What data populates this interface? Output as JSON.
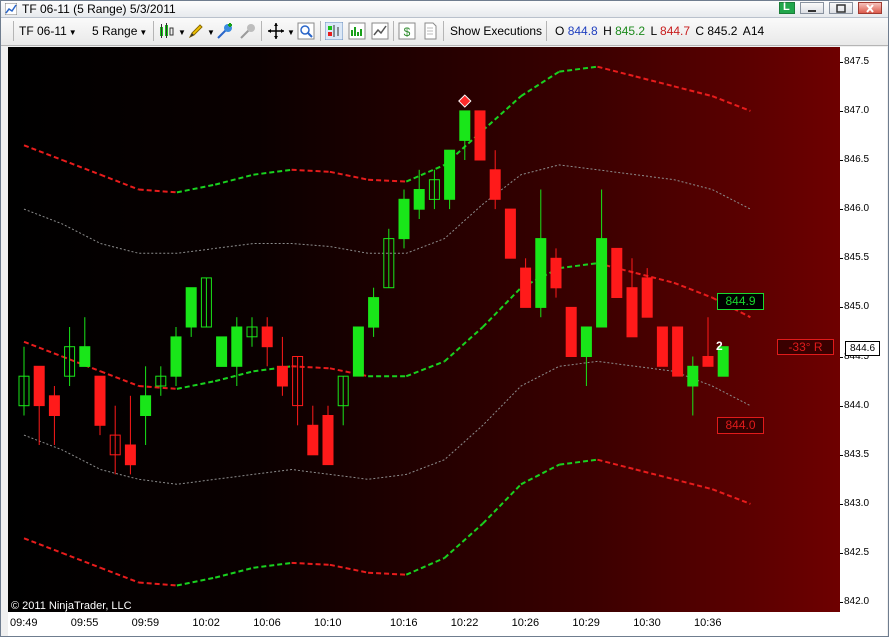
{
  "window": {
    "title": "TF 06-11 (5 Range)  5/3/2011",
    "link_button": "L"
  },
  "toolbar": {
    "instrument": "TF 06-11",
    "period": "5 Range",
    "show_executions": "Show Executions",
    "ohlc": {
      "o_label": "O",
      "o_value": "844.8",
      "h_label": "H",
      "h_value": "845.2",
      "l_label": "L",
      "l_value": "844.7",
      "c_label": "C",
      "c_value": "845.2",
      "a_label": "A",
      "a_value": "14"
    }
  },
  "chart": {
    "copyright": "© 2011 NinjaTrader, LLC",
    "last_price": "844.6",
    "upper_label": "844.9",
    "lower_label": "844.0",
    "angle_label": "-33°  R",
    "count_label": "2",
    "colors": {
      "up_candle": "#19e619",
      "down_candle": "#ff1a1a",
      "band_up": "#19d11f",
      "band_down": "#e81c1c",
      "mid_line": "#8c8c8c",
      "signal": "#ff2a2a"
    }
  },
  "y_axis": {
    "ticks": [
      "847.5",
      "847.0",
      "846.5",
      "846.0",
      "845.5",
      "845.0",
      "844.5",
      "844.0",
      "843.5",
      "843.0",
      "842.5",
      "842.0"
    ]
  },
  "x_axis": {
    "ticks": [
      "09:49",
      "09:55",
      "09:59",
      "10:02",
      "10:06",
      "10:10",
      "10:16",
      "10:22",
      "10:26",
      "10:29",
      "10:30",
      "10:36"
    ]
  },
  "chart_data": {
    "type": "candlestick",
    "title": "",
    "x_axis_ticks": [
      "09:49",
      "09:55",
      "09:59",
      "10:02",
      "10:06",
      "10:10",
      "10:16",
      "10:22",
      "10:26",
      "10:29",
      "10:30",
      "10:36"
    ],
    "ylim": [
      841.9,
      847.65
    ],
    "bars": [
      {
        "o": 844.0,
        "h": 844.6,
        "l": 843.9,
        "c": 844.3
      },
      {
        "o": 844.4,
        "h": 844.4,
        "l": 843.6,
        "c": 844.0
      },
      {
        "o": 844.1,
        "h": 844.2,
        "l": 843.6,
        "c": 843.9
      },
      {
        "o": 844.3,
        "h": 844.8,
        "l": 844.2,
        "c": 844.6
      },
      {
        "o": 844.4,
        "h": 844.9,
        "l": 844.4,
        "c": 844.6
      },
      {
        "o": 844.3,
        "h": 844.3,
        "l": 843.7,
        "c": 843.8
      },
      {
        "o": 843.7,
        "h": 844.0,
        "l": 843.3,
        "c": 843.5
      },
      {
        "o": 843.6,
        "h": 844.1,
        "l": 843.3,
        "c": 843.4
      },
      {
        "o": 843.9,
        "h": 844.4,
        "l": 843.6,
        "c": 844.1
      },
      {
        "o": 844.2,
        "h": 844.4,
        "l": 844.1,
        "c": 844.3
      },
      {
        "o": 844.3,
        "h": 844.8,
        "l": 844.2,
        "c": 844.7
      },
      {
        "o": 844.8,
        "h": 845.2,
        "l": 844.7,
        "c": 845.2
      },
      {
        "o": 844.8,
        "h": 845.3,
        "l": 844.8,
        "c": 845.3
      },
      {
        "o": 844.4,
        "h": 844.7,
        "l": 844.4,
        "c": 844.7
      },
      {
        "o": 844.4,
        "h": 844.9,
        "l": 844.2,
        "c": 844.8
      },
      {
        "o": 844.7,
        "h": 844.9,
        "l": 844.6,
        "c": 844.8
      },
      {
        "o": 844.8,
        "h": 844.9,
        "l": 844.4,
        "c": 844.6
      },
      {
        "o": 844.4,
        "h": 844.7,
        "l": 844.1,
        "c": 844.2
      },
      {
        "o": 844.5,
        "h": 844.5,
        "l": 843.8,
        "c": 844.0
      },
      {
        "o": 843.8,
        "h": 844.0,
        "l": 843.5,
        "c": 843.5
      },
      {
        "o": 843.9,
        "h": 844.0,
        "l": 843.4,
        "c": 843.4
      },
      {
        "o": 844.0,
        "h": 844.3,
        "l": 843.8,
        "c": 844.3
      },
      {
        "o": 844.3,
        "h": 844.8,
        "l": 844.3,
        "c": 844.8
      },
      {
        "o": 844.8,
        "h": 845.2,
        "l": 844.7,
        "c": 845.1
      },
      {
        "o": 845.2,
        "h": 845.8,
        "l": 845.2,
        "c": 845.7
      },
      {
        "o": 845.7,
        "h": 846.2,
        "l": 845.6,
        "c": 846.1
      },
      {
        "o": 846.0,
        "h": 846.4,
        "l": 845.9,
        "c": 846.2
      },
      {
        "o": 846.1,
        "h": 846.4,
        "l": 846.0,
        "c": 846.3
      },
      {
        "o": 846.1,
        "h": 846.4,
        "l": 846.0,
        "c": 846.6
      },
      {
        "o": 846.7,
        "h": 847.0,
        "l": 846.5,
        "c": 847.0
      },
      {
        "o": 847.0,
        "h": 847.0,
        "l": 846.5,
        "c": 846.5
      },
      {
        "o": 846.4,
        "h": 846.6,
        "l": 846.0,
        "c": 846.1
      },
      {
        "o": 846.0,
        "h": 846.0,
        "l": 845.5,
        "c": 845.5
      },
      {
        "o": 845.4,
        "h": 845.5,
        "l": 845.0,
        "c": 845.0
      },
      {
        "o": 845.0,
        "h": 846.2,
        "l": 844.9,
        "c": 845.7
      },
      {
        "o": 845.5,
        "h": 845.6,
        "l": 845.1,
        "c": 845.2
      },
      {
        "o": 845.0,
        "h": 845.0,
        "l": 844.5,
        "c": 844.5
      },
      {
        "o": 844.5,
        "h": 844.8,
        "l": 844.2,
        "c": 844.8
      },
      {
        "o": 844.8,
        "h": 846.2,
        "l": 844.8,
        "c": 845.7
      },
      {
        "o": 845.6,
        "h": 845.6,
        "l": 845.1,
        "c": 845.1
      },
      {
        "o": 845.2,
        "h": 845.5,
        "l": 844.7,
        "c": 844.7
      },
      {
        "o": 845.3,
        "h": 845.4,
        "l": 844.9,
        "c": 844.9
      },
      {
        "o": 844.8,
        "h": 844.8,
        "l": 844.4,
        "c": 844.4
      },
      {
        "o": 844.8,
        "h": 844.8,
        "l": 844.3,
        "c": 844.3
      },
      {
        "o": 844.2,
        "h": 844.5,
        "l": 843.9,
        "c": 844.4
      },
      {
        "o": 844.5,
        "h": 844.9,
        "l": 844.4,
        "c": 844.4
      },
      {
        "o": 844.3,
        "h": 844.6,
        "l": 844.3,
        "c": 844.6
      }
    ],
    "bands": {
      "outer_upper": [
        846.65,
        846.5,
        846.35,
        846.2,
        846.17,
        846.25,
        846.35,
        846.4,
        846.38,
        846.3,
        846.28,
        846.45,
        846.8,
        847.15,
        847.4,
        847.45,
        847.35,
        847.25,
        847.15,
        847.0
      ],
      "middle": [
        846.0,
        845.85,
        845.65,
        845.55,
        845.55,
        845.6,
        845.65,
        845.65,
        845.62,
        845.55,
        845.55,
        845.7,
        846.05,
        846.35,
        846.45,
        846.4,
        846.35,
        846.3,
        846.2,
        846.0
      ],
      "inner_upper": [
        844.65,
        844.5,
        844.35,
        844.2,
        844.17,
        844.25,
        844.35,
        844.4,
        844.38,
        844.3,
        844.3,
        844.45,
        844.8,
        845.2,
        845.4,
        845.45,
        845.35,
        845.25,
        845.1,
        844.9
      ],
      "inner_middle": [
        843.7,
        843.55,
        843.35,
        843.25,
        843.2,
        843.25,
        843.3,
        843.35,
        843.3,
        843.25,
        843.3,
        843.45,
        843.8,
        844.2,
        844.4,
        844.45,
        844.4,
        844.35,
        844.2,
        844.0
      ],
      "outer_lower": [
        842.65,
        842.5,
        842.35,
        842.2,
        842.17,
        842.25,
        842.35,
        842.4,
        842.38,
        842.3,
        842.28,
        842.45,
        842.8,
        843.2,
        843.4,
        843.45,
        843.35,
        843.25,
        843.15,
        843.0
      ]
    },
    "signal_marker": {
      "bar_index": 29,
      "price": 847.1
    }
  }
}
